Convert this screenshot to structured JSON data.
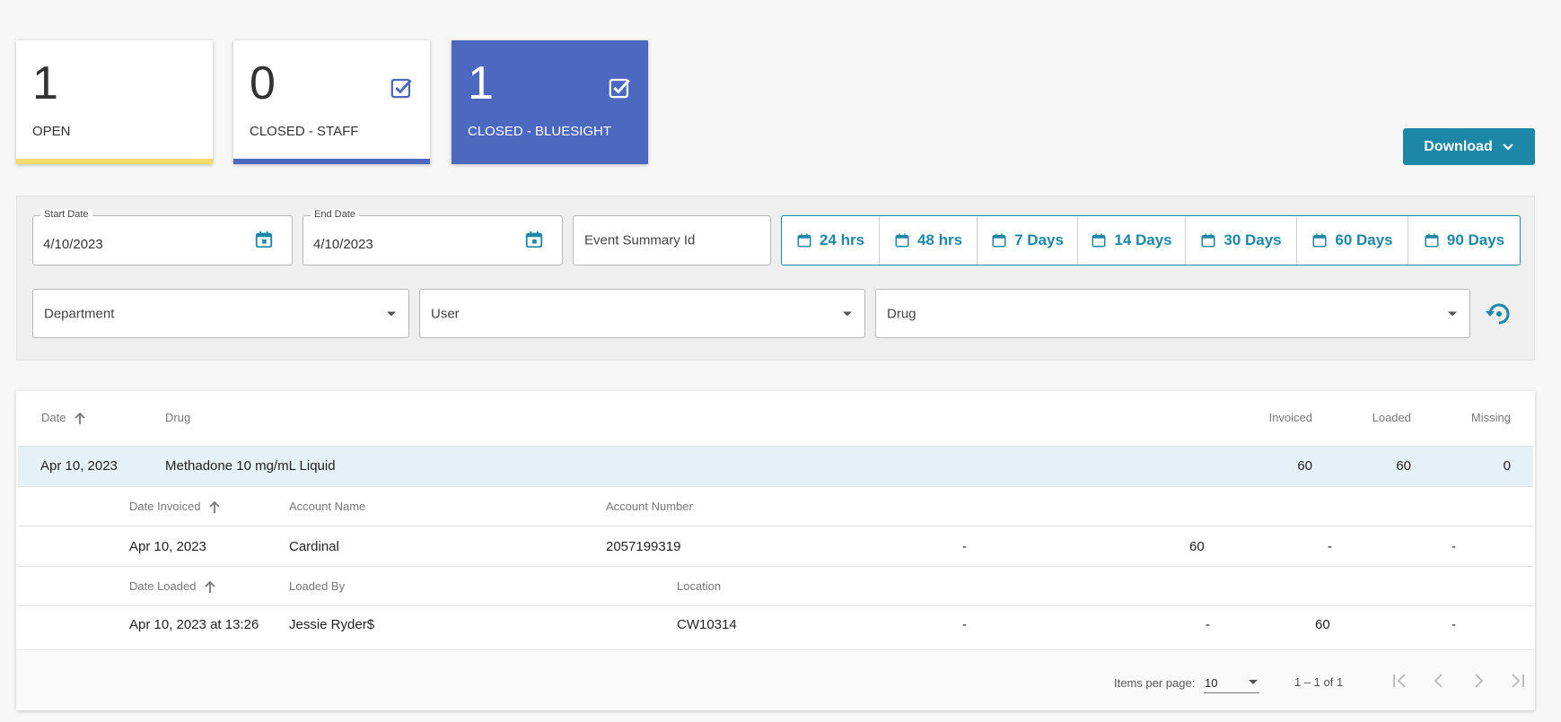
{
  "cards": [
    {
      "count": "1",
      "label": "OPEN",
      "bar_color": "#f3dc6a",
      "checked": false,
      "active": false
    },
    {
      "count": "0",
      "label": "CLOSED - STAFF",
      "bar_color": "#4c68bf",
      "checked": true,
      "active": false
    },
    {
      "count": "1",
      "label": "CLOSED - BLUESIGHT",
      "bar_color": "#4c68bf",
      "checked": true,
      "active": true
    }
  ],
  "download": {
    "label": "Download",
    "icon": "chevron-down-icon"
  },
  "filters": {
    "start_date": {
      "label": "Start Date",
      "value": "4/10/2023"
    },
    "end_date": {
      "label": "End Date",
      "value": "4/10/2023"
    },
    "event_summary": {
      "placeholder": "Event Summary Id"
    },
    "quick_ranges": [
      "24 hrs",
      "48 hrs",
      "7 Days",
      "14 Days",
      "30 Days",
      "60 Days",
      "90 Days"
    ],
    "department": {
      "placeholder": "Department"
    },
    "user": {
      "placeholder": "User"
    },
    "drug": {
      "placeholder": "Drug"
    }
  },
  "table": {
    "headers": {
      "date": "Date",
      "drug": "Drug",
      "invoiced": "Invoiced",
      "loaded": "Loaded",
      "missing": "Missing"
    },
    "main_row": {
      "date": "Apr 10, 2023",
      "drug": "Methadone 10 mg/mL Liquid",
      "invoiced": "60",
      "loaded": "60",
      "missing": "0"
    },
    "invoice_headers": {
      "date_invoiced": "Date Invoiced",
      "account_name": "Account Name",
      "account_number": "Account Number"
    },
    "invoice_row": {
      "date": "Apr 10, 2023",
      "account_name": "Cardinal",
      "account_number": "2057199319",
      "c1": "-",
      "c2": "60",
      "c3": "-",
      "c4": "-"
    },
    "loaded_headers": {
      "date_loaded": "Date Loaded",
      "loaded_by": "Loaded By",
      "location": "Location"
    },
    "loaded_row": {
      "date": "Apr 10, 2023 at 13:26",
      "loaded_by": "Jessie Ryder$",
      "location": "CW10314",
      "c1": "-",
      "c2": "-",
      "c3": "60",
      "c4": "-"
    }
  },
  "pager": {
    "items_per_page_label": "Items per page:",
    "items_per_page": "10",
    "range": "1 – 1 of 1"
  },
  "colors": {
    "accent": "#1d87a8",
    "brand_blue": "#4c68bf",
    "open_yellow": "#f3dc6a",
    "row_highlight": "#e6f1f6"
  }
}
